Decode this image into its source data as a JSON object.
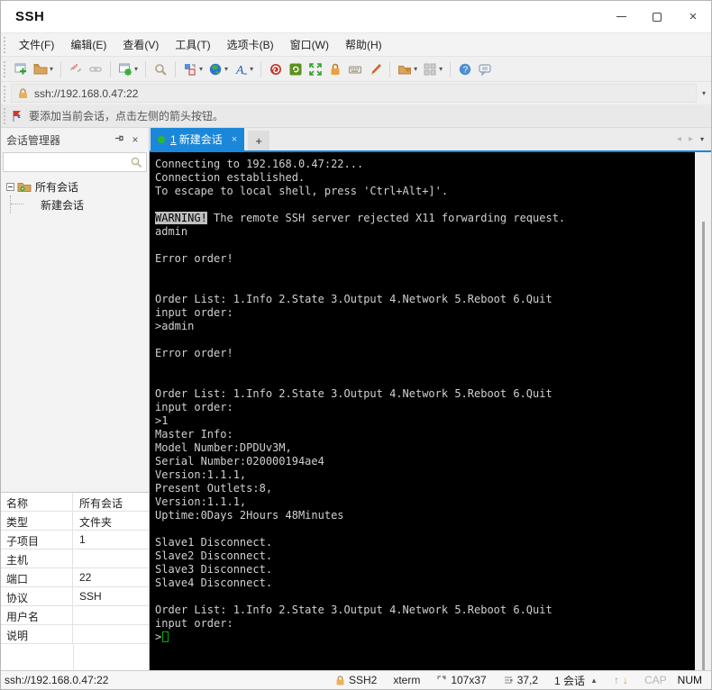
{
  "window": {
    "title": "SSH"
  },
  "icons": {
    "close_glyph": "×",
    "plus_glyph": "+",
    "tab_scroll_left": "◂",
    "tab_scroll_right": "▸",
    "dropdown_glyph": "▾",
    "pin_glyph": "⊣",
    "up_arrow": "↑",
    "down_arrow": "↓",
    "expand_tri": "▲"
  },
  "menu": {
    "items": [
      "文件(F)",
      "编辑(E)",
      "查看(V)",
      "工具(T)",
      "选项卡(B)",
      "窗口(W)",
      "帮助(H)"
    ]
  },
  "address_bar": {
    "url": "ssh://192.168.0.47:22"
  },
  "notice": {
    "text": "要添加当前会话，点击左侧的箭头按钮。"
  },
  "session_manager": {
    "title": "会话管理器",
    "search_placeholder": "",
    "tree": {
      "root": "所有会话",
      "child": "新建会话"
    }
  },
  "tabs": {
    "active": {
      "index": "1",
      "label": "新建会话"
    }
  },
  "properties": {
    "rows": [
      {
        "label": "名称",
        "value": "所有会话"
      },
      {
        "label": "类型",
        "value": "文件夹"
      },
      {
        "label": "子项目",
        "value": "1"
      },
      {
        "label": "主机",
        "value": ""
      },
      {
        "label": "端口",
        "value": "22"
      },
      {
        "label": "协议",
        "value": "SSH"
      },
      {
        "label": "用户名",
        "value": ""
      },
      {
        "label": "说明",
        "value": ""
      }
    ]
  },
  "terminal": {
    "inverse_token": "WARNING!",
    "lines": [
      "Connecting to 192.168.0.47:22...",
      "Connection established.",
      "To escape to local shell, press 'Ctrl+Alt+]'.",
      "",
      "WARNING! The remote SSH server rejected X11 forwarding request.",
      "admin",
      "",
      "Error order!",
      "",
      "",
      "Order List: 1.Info 2.State 3.Output 4.Network 5.Reboot 6.Quit",
      "input order:",
      ">admin",
      "",
      "Error order!",
      "",
      "",
      "Order List: 1.Info 2.State 3.Output 4.Network 5.Reboot 6.Quit",
      "input order:",
      ">1",
      "Master Info:",
      "Model Number:DPDUv3M,",
      "Serial Number:020000194ae4",
      "Version:1.1.1,",
      "Present Outlets:8,",
      "Version:1.1.1,",
      "Uptime:0Days 2Hours 48Minutes",
      "",
      "Slave1 Disconnect.",
      "Slave2 Disconnect.",
      "Slave3 Disconnect.",
      "Slave4 Disconnect.",
      "",
      "Order List: 1.Info 2.State 3.Output 4.Network 5.Reboot 6.Quit",
      "input order:",
      ">"
    ]
  },
  "status_bar": {
    "url": "ssh://192.168.0.47:22",
    "protocol": "SSH2",
    "term_type": "xterm",
    "size": "107x37",
    "cursor_pos": "37,2",
    "session_count": "1 会话",
    "cap_label": "CAP",
    "num_label": "NUM"
  },
  "colors": {
    "accent_blue": "#1b87d9",
    "tab_green_dot": "#2db82d",
    "terminal_bg": "#000000",
    "terminal_fg": "#d0d0d0",
    "cursor_green": "#00b000",
    "inverse_bg": "#c0c0c0",
    "lock_orange": "#e8b15c"
  }
}
